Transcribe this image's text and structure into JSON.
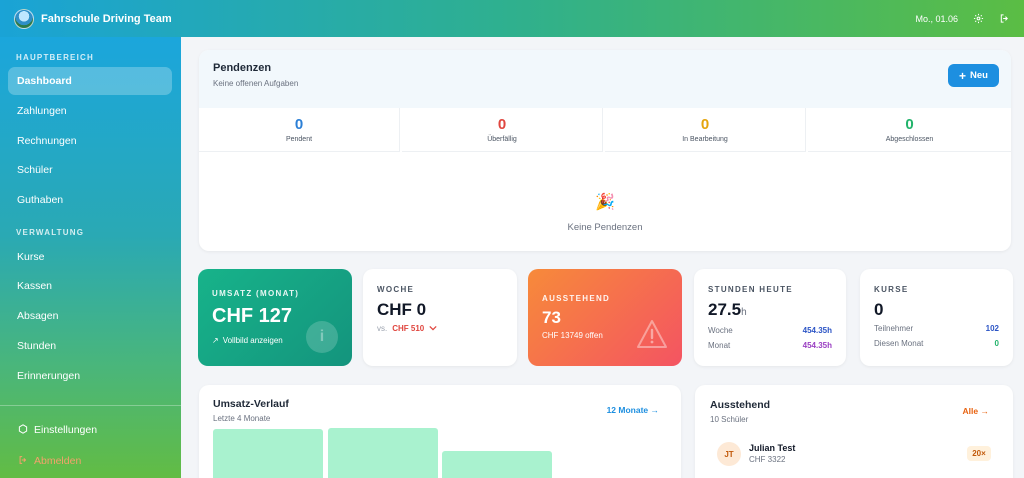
{
  "header": {
    "brand": "Fahrschule Driving Team",
    "date": "Mo., 01.06",
    "settings_icon": "gear-icon",
    "logout_icon": "logout-icon"
  },
  "sidebar": {
    "section_main": "HAUPTBEREICH",
    "main_items": [
      {
        "label": "Dashboard"
      },
      {
        "label": "Zahlungen"
      },
      {
        "label": "Rechnungen"
      },
      {
        "label": "Schüler"
      },
      {
        "label": "Guthaben"
      }
    ],
    "section_admin": "VERWALTUNG",
    "admin_items": [
      {
        "label": "Kurse"
      },
      {
        "label": "Kassen"
      },
      {
        "label": "Absagen"
      },
      {
        "label": "Stunden"
      },
      {
        "label": "Erinnerungen"
      }
    ],
    "settings": "Einstellungen",
    "logout": "Abmelden"
  },
  "pending": {
    "title": "Pendenzen",
    "subtitle": "Keine offenen Aufgaben",
    "new_button": "Neu",
    "stats": [
      {
        "value": "0",
        "label": "Pendent",
        "color": "#2b7fd6"
      },
      {
        "value": "0",
        "label": "Überfällig",
        "color": "#e0463f"
      },
      {
        "value": "0",
        "label": "In Bearbeitung",
        "color": "#e5a50d"
      },
      {
        "value": "0",
        "label": "Abgeschlossen",
        "color": "#22b36b"
      }
    ],
    "empty_text": "Keine Pendenzen"
  },
  "kpis": {
    "umsatz": {
      "label": "UMSATZ (MONAT)",
      "value": "CHF 127",
      "link": "Vollbild anzeigen"
    },
    "woche": {
      "label": "WOCHE",
      "value": "CHF 0",
      "vs_prefix": "vs.",
      "vs_value": "CHF 510"
    },
    "ausstehend": {
      "label": "AUSSTEHEND",
      "value": "73",
      "sub": "CHF 13749 offen"
    },
    "stunden": {
      "label": "STUNDEN HEUTE",
      "value": "27.5",
      "unit": "h",
      "rows": [
        {
          "label": "Woche",
          "value": "454.35h"
        },
        {
          "label": "Monat",
          "value": "454.35h"
        }
      ]
    },
    "kurse": {
      "label": "KURSE",
      "value": "0",
      "rows": [
        {
          "label": "Teilnehmer",
          "value": "102"
        },
        {
          "label": "Diesen Monat",
          "value": "0"
        }
      ]
    }
  },
  "umsatz_verlauf": {
    "title": "Umsatz-Verlauf",
    "subtitle": "Letzte 4 Monate",
    "link": "12 Monate →"
  },
  "chart_data": {
    "type": "bar",
    "categories": [
      "",
      "",
      "",
      ""
    ],
    "values": [
      null,
      null,
      null,
      null
    ],
    "title": "Umsatz-Verlauf"
  },
  "outstanding": {
    "title": "Ausstehend",
    "subtitle": "10 Schüler",
    "link": "Alle →",
    "entries": [
      {
        "initials": "JT",
        "name": "Julian Test",
        "amount": "CHF 3322",
        "badge": "20×"
      }
    ]
  }
}
